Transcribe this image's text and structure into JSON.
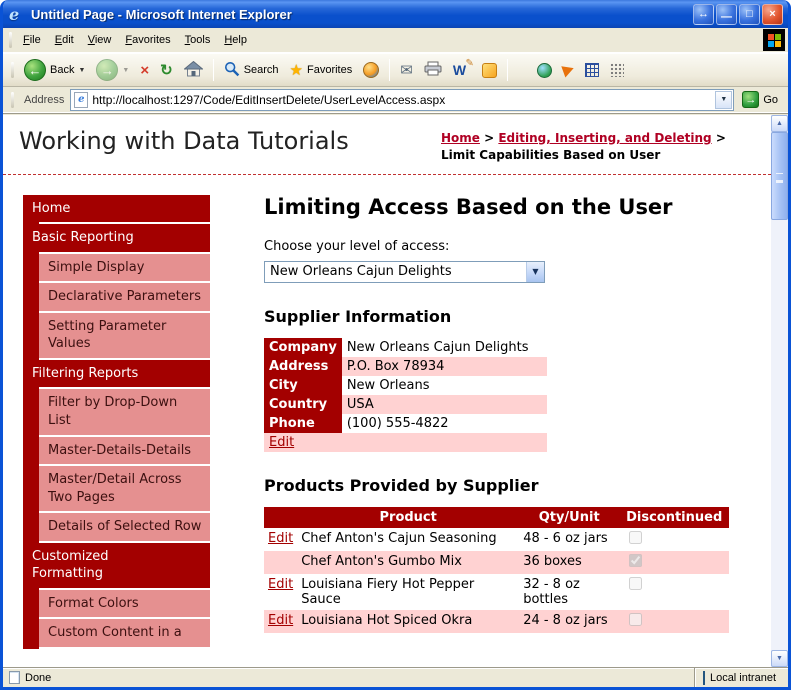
{
  "window": {
    "title": "Untitled Page - Microsoft Internet Explorer"
  },
  "menu": {
    "items": [
      "File",
      "Edit",
      "View",
      "Favorites",
      "Tools",
      "Help"
    ]
  },
  "toolbar": {
    "back_label": "Back",
    "search_label": "Search",
    "favorites_label": "Favorites"
  },
  "address": {
    "label": "Address",
    "url": "http://localhost:1297/Code/EditInsertDelete/UserLevelAccess.aspx",
    "go_label": "Go"
  },
  "statusbar": {
    "left": "Done",
    "zone": "Local intranet"
  },
  "sidebar": {
    "items": [
      {
        "label": "Home",
        "type": "header"
      },
      {
        "label": "Basic Reporting",
        "type": "header"
      },
      {
        "label": "Simple Display",
        "type": "sub"
      },
      {
        "label": "Declarative Parameters",
        "type": "sub"
      },
      {
        "label": "Setting Parameter Values",
        "type": "sub"
      },
      {
        "label": "Filtering Reports",
        "type": "header"
      },
      {
        "label": "Filter by Drop-Down List",
        "type": "sub"
      },
      {
        "label": "Master-Details-Details",
        "type": "sub"
      },
      {
        "label": "Master/Detail Across Two Pages",
        "type": "sub"
      },
      {
        "label": "Details of Selected Row",
        "type": "sub"
      },
      {
        "label": "Customized Formatting",
        "type": "header"
      },
      {
        "label": "Format Colors",
        "type": "sub"
      },
      {
        "label": "Custom Content in a",
        "type": "sub"
      }
    ]
  },
  "page": {
    "site_title": "Working with Data Tutorials",
    "breadcrumb": {
      "home": "Home",
      "sep1": " > ",
      "section": "Editing, Inserting, and Deleting",
      "sep2": " > ",
      "current": "Limit Capabilities Based on User"
    },
    "heading": "Limiting Access Based on the User",
    "access_label": "Choose your level of access:",
    "access_value": "New Orleans Cajun Delights",
    "supplier": {
      "heading": "Supplier Information",
      "rows": [
        {
          "label": "Company",
          "value": "New Orleans Cajun Delights"
        },
        {
          "label": "Address",
          "value": "P.O. Box 78934"
        },
        {
          "label": "City",
          "value": "New Orleans"
        },
        {
          "label": "Country",
          "value": "USA"
        },
        {
          "label": "Phone",
          "value": "(100) 555-4822"
        }
      ],
      "edit_label": "Edit"
    },
    "products": {
      "heading": "Products Provided by Supplier",
      "columns": [
        "",
        "Product",
        "Qty/Unit",
        "Discontinued"
      ],
      "rows": [
        {
          "edit": "Edit",
          "product": "Chef Anton's Cajun Seasoning",
          "qty": "48 - 6 oz jars",
          "discontinued": false
        },
        {
          "edit": "",
          "product": "Chef Anton's Gumbo Mix",
          "qty": "36 boxes",
          "discontinued": true
        },
        {
          "edit": "Edit",
          "product": "Louisiana Fiery Hot Pepper Sauce",
          "qty": "32 - 8 oz bottles",
          "discontinued": false
        },
        {
          "edit": "Edit",
          "product": "Louisiana Hot Spiced Okra",
          "qty": "24 - 8 oz jars",
          "discontinued": false
        }
      ]
    }
  },
  "icons": {
    "ie_logo": "e",
    "resize": "↔",
    "minimize": "—",
    "maximize": "□",
    "close": "×",
    "back_arrow": "←",
    "forward_arrow": "→",
    "stop": "×",
    "refresh": "↻",
    "star": "★",
    "mail": "✉",
    "word": "W",
    "pencil": "✎",
    "chevron_down": "▼",
    "scroll_up": "▲",
    "scroll_down": "▼"
  },
  "colors": {
    "maroon": "#a30000",
    "salmon": "#e59090",
    "row_pink": "#ffd2d2",
    "xp_title_blue": "#0a50cc",
    "chrome": "#ece9d8",
    "link_red": "#b00023"
  }
}
